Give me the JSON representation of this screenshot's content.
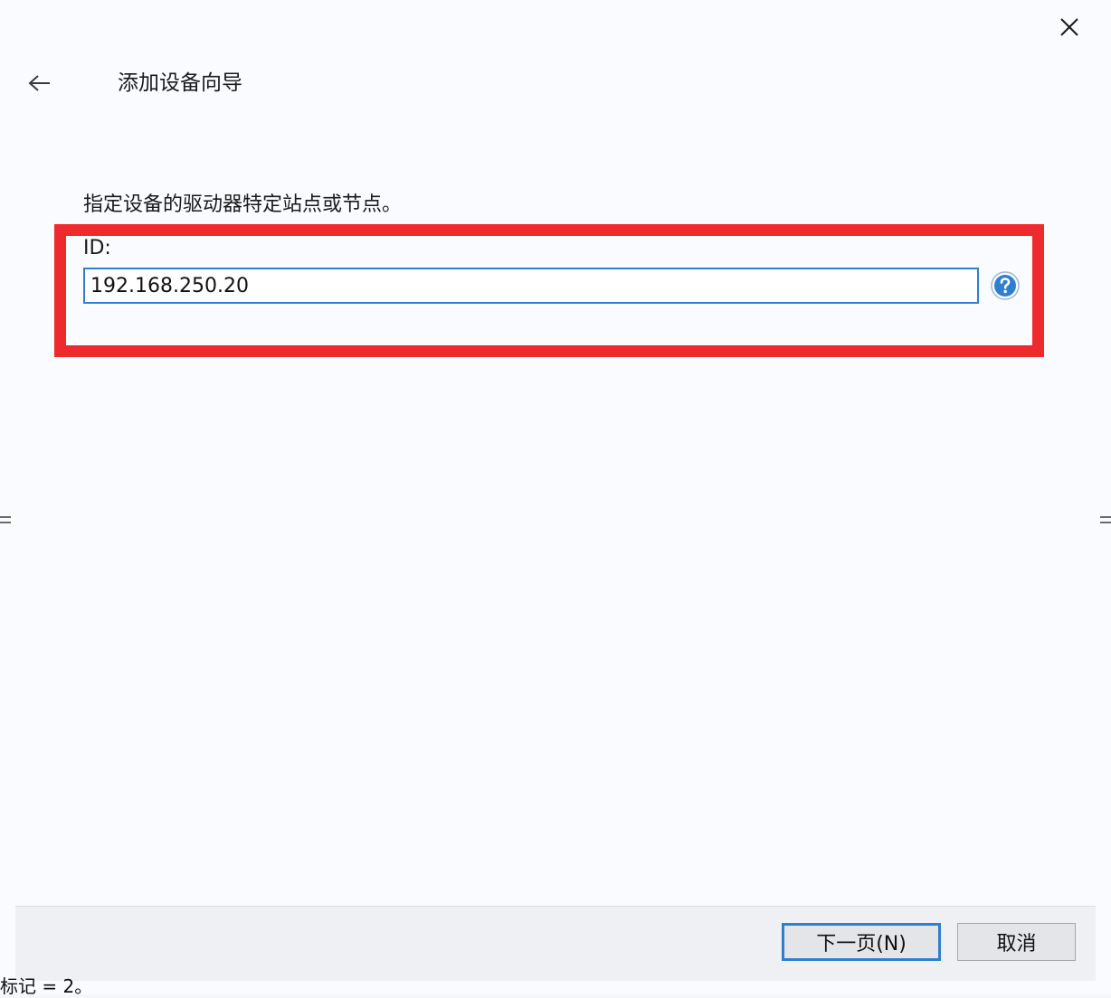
{
  "window": {
    "title": "添加设备向导",
    "close_icon": "close-icon",
    "back_icon": "arrow-left-icon"
  },
  "content": {
    "instruction": "指定设备的驱动器特定站点或节点。",
    "id_label": "ID:",
    "id_value": "192.168.250.20",
    "help_icon": "help-icon"
  },
  "footer": {
    "next_label": "下一页(N)",
    "cancel_label": "取消"
  },
  "below_window": {
    "text_fragment": "标记 = 2。"
  },
  "colors": {
    "highlight": "#ef2a2e",
    "accent": "#2f7fd1",
    "background": "#f9fbfe",
    "footer": "#eef0f3"
  }
}
